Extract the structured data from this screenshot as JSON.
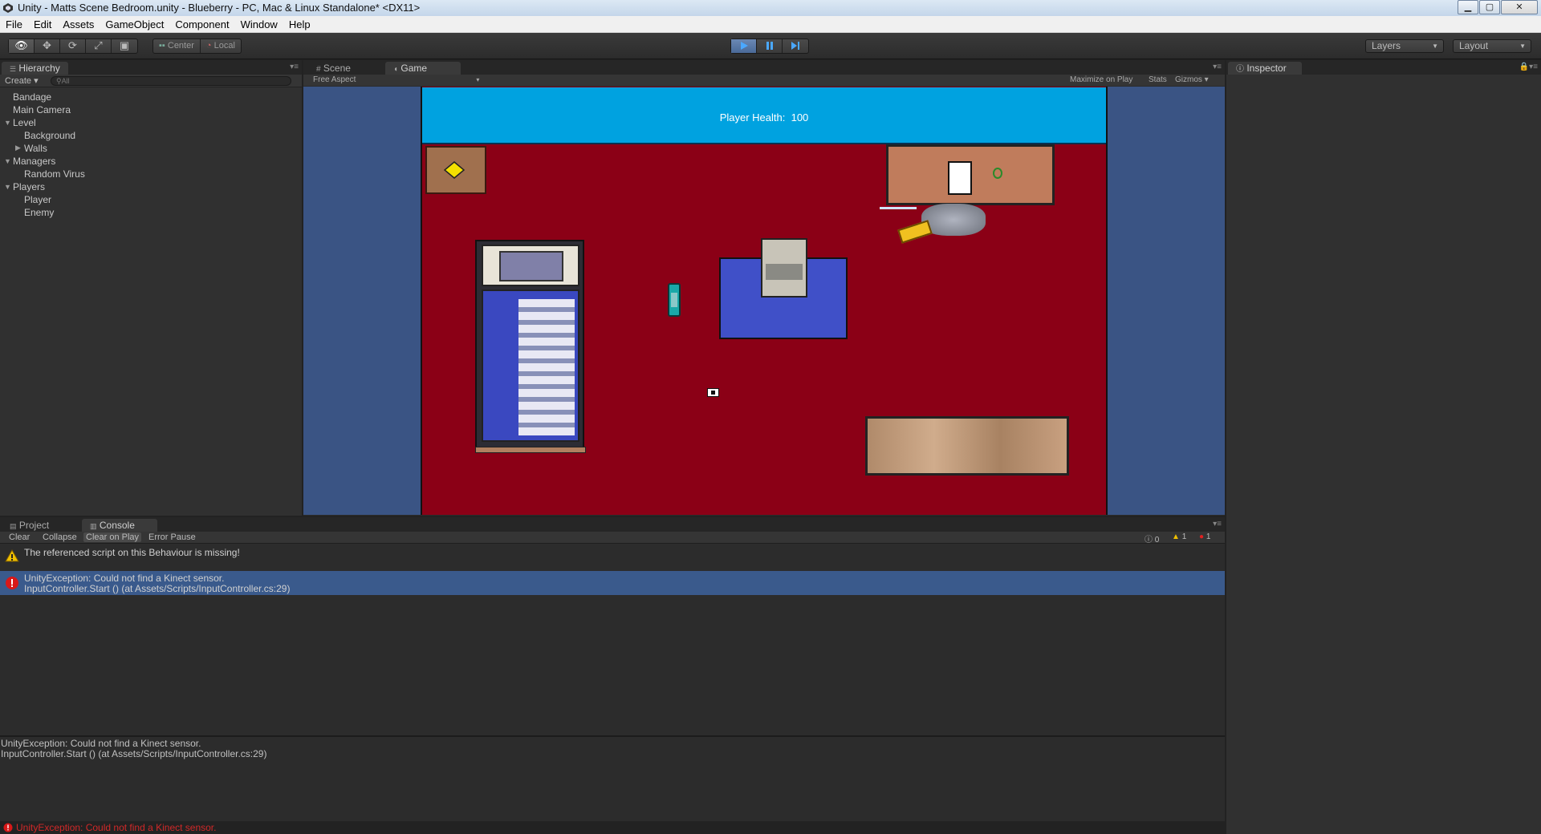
{
  "window": {
    "title": "Unity - Matts Scene Bedroom.unity - Blueberry - PC, Mac & Linux Standalone* <DX11>",
    "controls": [
      "minimize",
      "maximize",
      "close"
    ]
  },
  "menu": [
    "File",
    "Edit",
    "Assets",
    "GameObject",
    "Component",
    "Window",
    "Help"
  ],
  "toolbar": {
    "pivot": {
      "center": "Center",
      "local": "Local"
    },
    "layers": "Layers",
    "layout": "Layout"
  },
  "hierarchy": {
    "tab": "Hierarchy",
    "create": "Create",
    "search_placeholder": "All",
    "items": [
      {
        "label": "Bandage"
      },
      {
        "label": "Main Camera"
      },
      {
        "label": "Level"
      },
      {
        "label": "Background"
      },
      {
        "label": "Walls"
      },
      {
        "label": "Managers"
      },
      {
        "label": "Random Virus"
      },
      {
        "label": "Players"
      },
      {
        "label": "Player"
      },
      {
        "label": "Enemy"
      }
    ]
  },
  "views": {
    "scene_tab": "Scene",
    "game_tab": "Game",
    "aspect": "Free Aspect",
    "maximize_on_play": "Maximize on Play",
    "stats": "Stats",
    "gizmos": "Gizmos"
  },
  "game": {
    "health_label": "Player Health:",
    "health_value": "100",
    "colors": {
      "background": "#3a5484",
      "floor": "#8b0016",
      "hud": "#00a2e0",
      "rug": "#4050c8"
    }
  },
  "inspector": {
    "tab": "Inspector"
  },
  "console": {
    "project_tab": "Project",
    "console_tab": "Console",
    "buttons": {
      "clear": "Clear",
      "collapse": "Collapse",
      "clear_on_play": "Clear on Play",
      "error_pause": "Error Pause"
    },
    "counts": {
      "info": "0",
      "warnings": "1",
      "errors": "1"
    },
    "logs": [
      {
        "type": "warning",
        "line1": "The referenced script on this Behaviour is missing!",
        "line2": ""
      },
      {
        "type": "error",
        "line1": "UnityException: Could not find a Kinect sensor.",
        "line2": "InputController.Start () (at Assets/Scripts/InputController.cs:29)"
      }
    ],
    "detail": {
      "line1": "UnityException: Could not find a Kinect sensor.",
      "line2": "InputController.Start () (at Assets/Scripts/InputController.cs:29)"
    },
    "status": "UnityException: Could not find a Kinect sensor."
  }
}
